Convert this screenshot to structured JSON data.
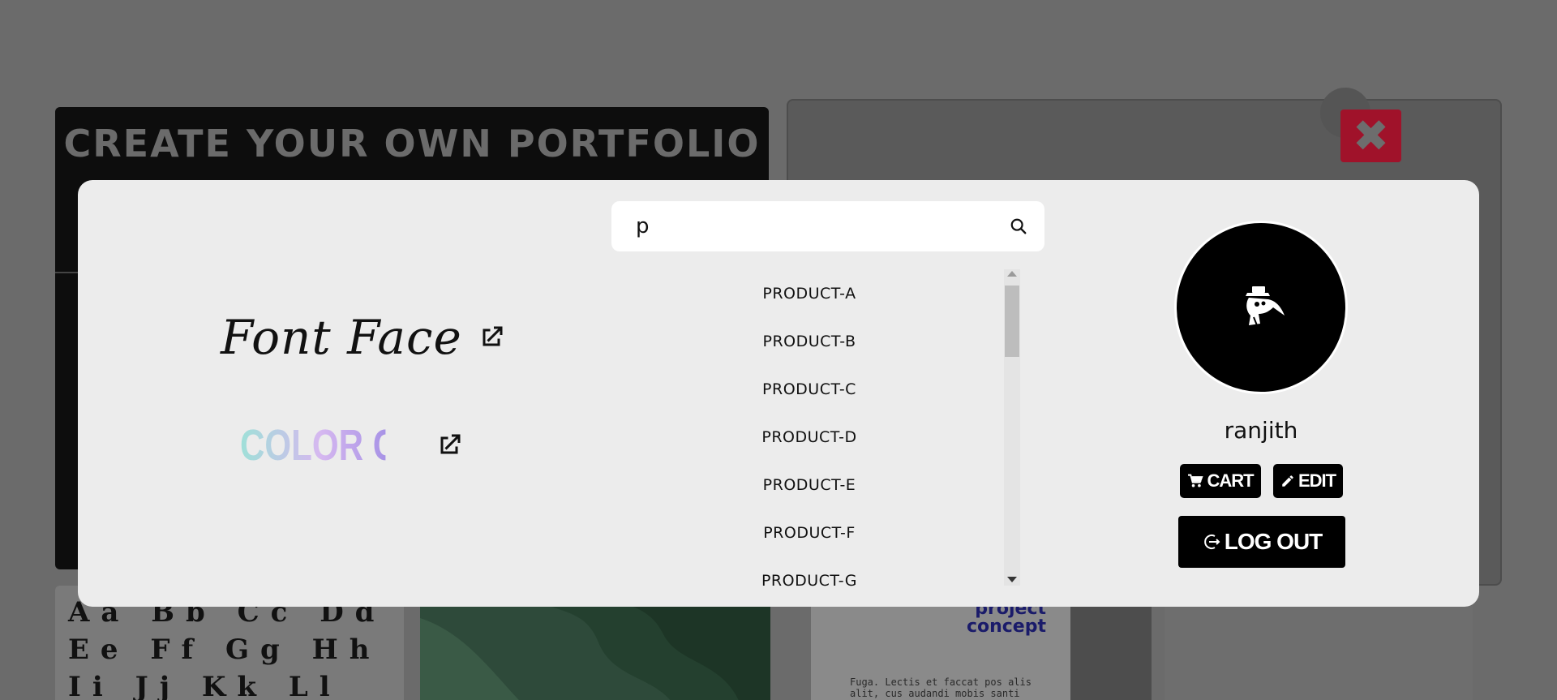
{
  "background": {
    "portfolio_title": "CREATE YOUR OWN PORTFOLIO",
    "close_icon": "close-icon",
    "alphabet_tile": "Aa Bb Cc Dd Ee Ff Gg Hh Ii Jj Kk Ll Mm Nn Oo Pp",
    "doc_heading": "project concept",
    "doc_text": "Fuga. Lectis et faccat pos alis alit, cus audandi mobis santi volecitin non corec-"
  },
  "modal": {
    "links": {
      "font_face": {
        "label": "Font Face",
        "icon": "external-link-icon"
      },
      "color_code": {
        "label": "COLOR CODE",
        "icon": "external-link-icon"
      }
    },
    "search": {
      "value": "p",
      "icon": "search-icon"
    },
    "products": [
      {
        "label": "PRODUCT-A"
      },
      {
        "label": "PRODUCT-B"
      },
      {
        "label": "PRODUCT-C"
      },
      {
        "label": "PRODUCT-D"
      },
      {
        "label": "PRODUCT-E"
      },
      {
        "label": "PRODUCT-F"
      },
      {
        "label": "PRODUCT-G"
      }
    ],
    "profile": {
      "avatar_icon": "plague-doctor-icon",
      "username": "ranjith",
      "cart_label": "CART",
      "edit_label": "EDIT",
      "logout_label": "LOG OUT"
    }
  },
  "colors": {
    "overlay": "#6b6b6b",
    "modal_bg": "#ececec",
    "button_bg": "#000000",
    "close_red": "#a0122a"
  }
}
